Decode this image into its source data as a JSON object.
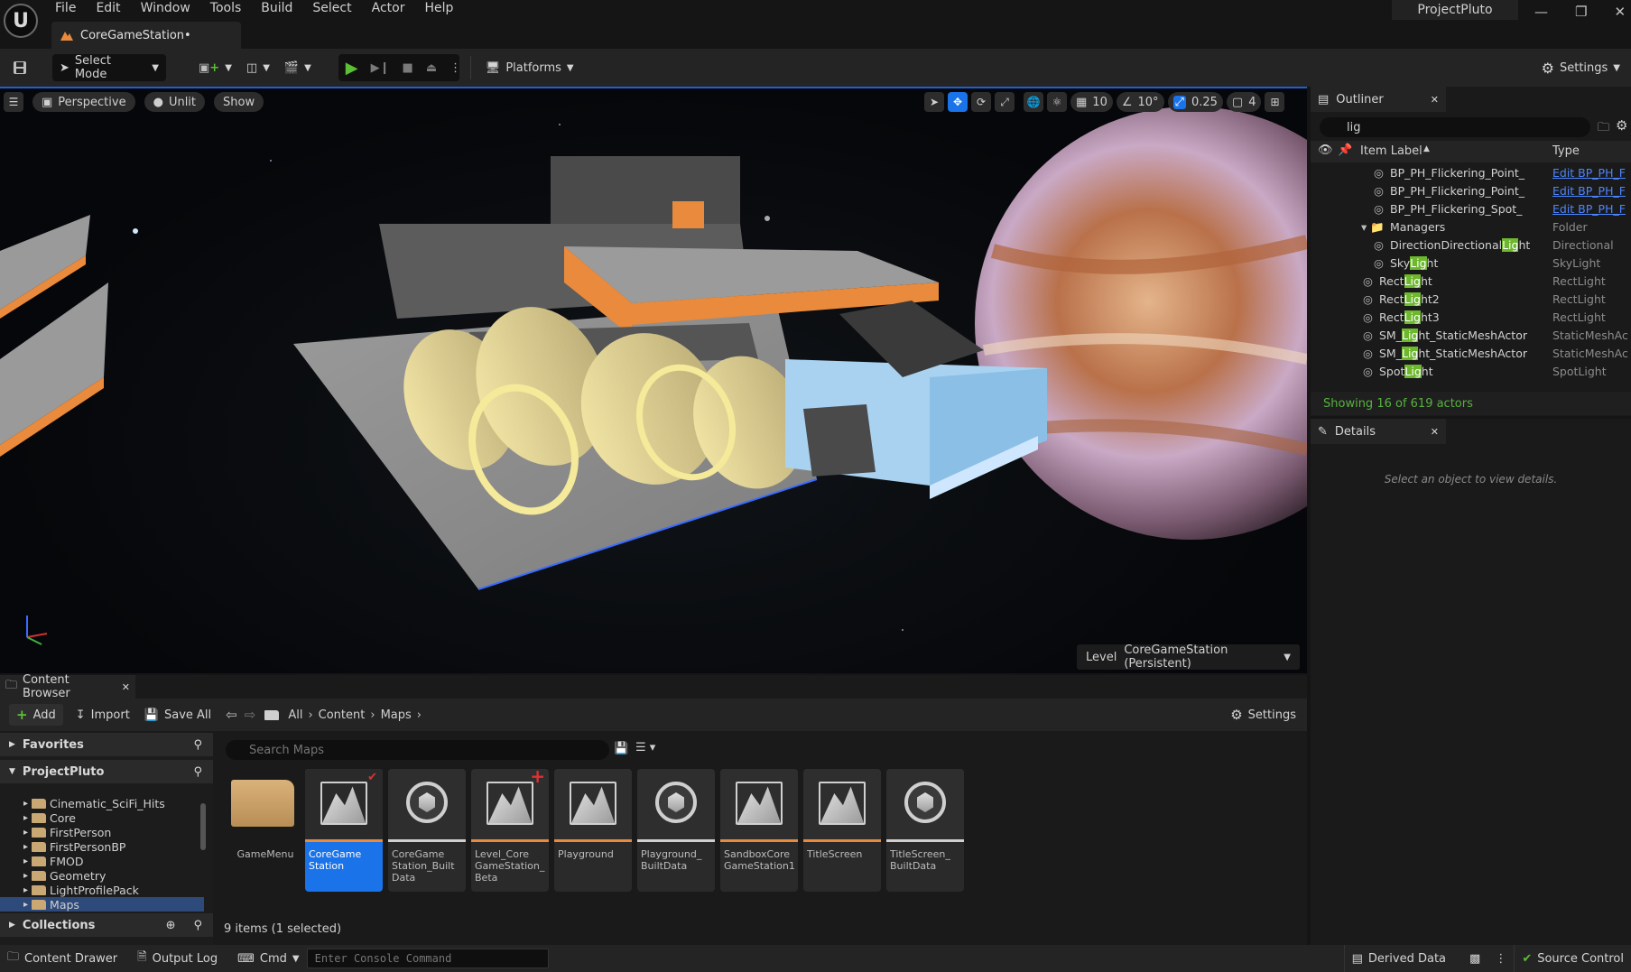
{
  "app": {
    "logo_letter": "U",
    "menu": [
      "File",
      "Edit",
      "Window",
      "Tools",
      "Build",
      "Select",
      "Actor",
      "Help"
    ],
    "project_name": "ProjectPluto",
    "doc_tab": "CoreGameStation•"
  },
  "toolbar": {
    "select_mode": "Select Mode",
    "platforms": "Platforms",
    "settings": "Settings"
  },
  "viewport": {
    "perspective": "Perspective",
    "unlit": "Unlit",
    "show": "Show",
    "grid_size": "10",
    "rotation_snap": "10°",
    "scale_snap": "0.25",
    "camera_speed": "4",
    "level_prefix": "Level",
    "level_name": "CoreGameStation (Persistent)"
  },
  "outliner": {
    "title": "Outliner",
    "search_value": "lig",
    "col_label": "Item Label",
    "col_type": "Type",
    "rows": [
      {
        "label_pre": "BP_PH_Flickering_Point_",
        "label_hl": "",
        "label_post": "",
        "type": "Edit BP_PH_F",
        "type_link": true,
        "indent": 88
      },
      {
        "label_pre": "BP_PH_Flickering_Point_",
        "label_hl": "",
        "label_post": "",
        "type": "Edit BP_PH_F",
        "type_link": true,
        "indent": 88
      },
      {
        "label_pre": "BP_PH_Flickering_Spot_",
        "label_hl": "",
        "label_post": "",
        "type": "Edit BP_PH_F",
        "type_link": true,
        "indent": 88
      },
      {
        "label_pre": "Managers",
        "label_hl": "",
        "label_post": "",
        "type": "Folder",
        "type_link": false,
        "indent": 88
      },
      {
        "label_pre": "DirectionDirectional",
        "label_hl": "Lig",
        "label_post": "ht",
        "type": "Directional",
        "type_link": false,
        "indent": 88
      },
      {
        "label_pre": "Sky",
        "label_hl": "Lig",
        "label_post": "ht",
        "type": "SkyLight",
        "type_link": false,
        "indent": 88
      },
      {
        "label_pre": "Rect",
        "label_hl": "Lig",
        "label_post": "ht",
        "type": "RectLight",
        "type_link": false,
        "indent": 76
      },
      {
        "label_pre": "Rect",
        "label_hl": "Lig",
        "label_post": "ht2",
        "type": "RectLight",
        "type_link": false,
        "indent": 76
      },
      {
        "label_pre": "Rect",
        "label_hl": "Lig",
        "label_post": "ht3",
        "type": "RectLight",
        "type_link": false,
        "indent": 76
      },
      {
        "label_pre": "SM_",
        "label_hl": "Lig",
        "label_post": "ht_StaticMeshActor",
        "type": "StaticMeshAc",
        "type_link": false,
        "indent": 76
      },
      {
        "label_pre": "SM_",
        "label_hl": "Lig",
        "label_post": "ht_StaticMeshActor",
        "type": "StaticMeshAc",
        "type_link": false,
        "indent": 76
      },
      {
        "label_pre": "Spot",
        "label_hl": "Lig",
        "label_post": "ht",
        "type": "SpotLight",
        "type_link": false,
        "indent": 76
      }
    ],
    "footer": "Showing 16 of 619 actors"
  },
  "details": {
    "title": "Details",
    "empty_text": "Select an object to view details."
  },
  "content_browser": {
    "tab": "Content Browser",
    "add": "Add",
    "import": "Import",
    "save_all": "Save All",
    "breadcrumbs": [
      "All",
      "Content",
      "Maps"
    ],
    "settings": "Settings",
    "favorites": "Favorites",
    "project": "ProjectPluto",
    "collections": "Collections",
    "tree": [
      "Cinematic_SciFi_Hits",
      "Core",
      "FirstPerson",
      "FirstPersonBP",
      "FMOD",
      "Geometry",
      "LightProfilePack",
      "Maps"
    ],
    "search_placeholder": "Search Maps",
    "assets": [
      {
        "name": "GameMenu",
        "kind": "folder",
        "bar": ""
      },
      {
        "name": "CoreGame Station",
        "kind": "map",
        "bar": "#e98a3c",
        "selected": true,
        "badge": "check"
      },
      {
        "name": "CoreGame Station_Built Data",
        "kind": "data",
        "bar": "#cfcfcf"
      },
      {
        "name": "Level_Core GameStation_ Beta",
        "kind": "map",
        "bar": "#e98a3c",
        "badge": "plus"
      },
      {
        "name": "Playground",
        "kind": "map",
        "bar": "#e98a3c"
      },
      {
        "name": "Playground_ BuiltData",
        "kind": "data",
        "bar": "#cfcfcf"
      },
      {
        "name": "SandboxCore GameStation1",
        "kind": "map",
        "bar": "#e98a3c"
      },
      {
        "name": "TitleScreen",
        "kind": "map",
        "bar": "#e98a3c"
      },
      {
        "name": "TitleScreen_ BuiltData",
        "kind": "data",
        "bar": "#cfcfcf"
      }
    ],
    "status": "9 items (1 selected)"
  },
  "statusbar": {
    "content_drawer": "Content Drawer",
    "output_log": "Output Log",
    "cmd": "Cmd",
    "console_placeholder": "Enter Console Command",
    "derived_data": "Derived Data",
    "source_control": "Source Control"
  },
  "colors": {
    "accent_blue": "#1a73e8",
    "play_green": "#5cc035",
    "highlight_green": "#6db82d",
    "link_blue": "#4d86ff",
    "map_orange": "#e98a3c"
  }
}
